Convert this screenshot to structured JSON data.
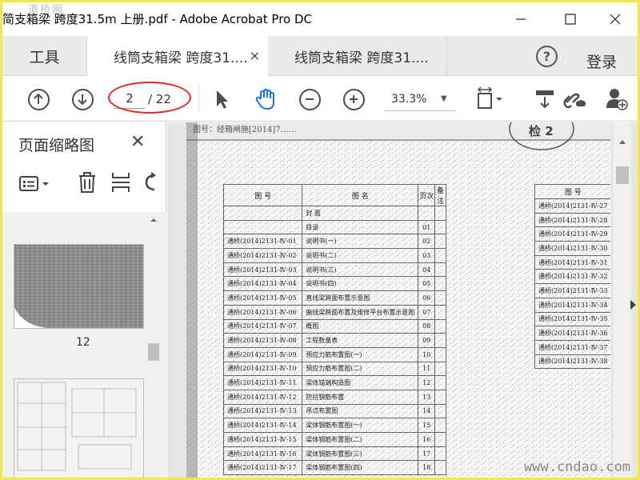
{
  "window": {
    "title": "简支箱梁 跨度31.5m 上册.pdf - Adobe Acrobat Pro DC",
    "watermark_top": "道桥网",
    "min_icon": "minimize-icon",
    "max_icon": "maximize-icon",
    "close_icon": "close-icon"
  },
  "tabs": {
    "tools": "工具",
    "active_label": "线筒支箱梁 跨度31....",
    "inactive_label": "线筒支箱梁 跨度31....",
    "close_glyph": "×",
    "help_glyph": "?",
    "login": "登录"
  },
  "toolbar": {
    "page_current": "2",
    "page_total": "/ 22",
    "zoom": "33.3%",
    "icons": [
      "prev-page-icon",
      "next-page-icon",
      "select-arrow-icon",
      "hand-tool-icon",
      "zoom-out-icon",
      "zoom-in-icon",
      "fit-page-icon",
      "scroll-mode-icon",
      "share-link-icon",
      "add-user-icon"
    ]
  },
  "sidebar": {
    "title": "页面缩略图",
    "close_glyph": "✕",
    "thumb_label": "12"
  },
  "document": {
    "header_fragment": "图号：经箱闸施[2014]7……",
    "stamp": "检 2",
    "table1_headers": [
      "图 号",
      "图 名",
      "页次",
      "备注"
    ],
    "table1_rows": [
      [
        "",
        "封 面",
        "",
        ""
      ],
      [
        "",
        "目录",
        "01",
        ""
      ],
      [
        "通桥(2014)2131-Ⅳ-01",
        "说明书(一)",
        "02",
        ""
      ],
      [
        "通桥(2014)2131-Ⅳ-02",
        "说明书(二)",
        "03",
        ""
      ],
      [
        "通桥(2014)2131-Ⅳ-03",
        "说明书(三)",
        "04",
        ""
      ],
      [
        "通桥(2014)2131-Ⅳ-04",
        "说明书(四)",
        "05",
        ""
      ],
      [
        "通桥(2014)2131-Ⅳ-05",
        "直线梁跨面布置示意图",
        "06",
        ""
      ],
      [
        "通桥(2014)2131-Ⅳ-06",
        "曲线梁跨面布置及维修平台布置示意图",
        "07",
        ""
      ],
      [
        "通桥(2014)2131-Ⅳ-07",
        "概图",
        "08",
        ""
      ],
      [
        "通桥(2014)2131-Ⅳ-08",
        "工程数量表",
        "09",
        ""
      ],
      [
        "通桥(2014)2131-Ⅳ-09",
        "预应力筋布置图(一)",
        "10",
        ""
      ],
      [
        "通桥(2014)2131-Ⅳ-10",
        "预应力筋布置图(二)",
        "11",
        ""
      ],
      [
        "通桥(2014)2131-Ⅳ-11",
        "梁体锚端构造图",
        "12",
        ""
      ],
      [
        "通桥(2014)2131-Ⅳ-12",
        "防拉钢筋布置",
        "13",
        ""
      ],
      [
        "通桥(2014)2131-Ⅳ-13",
        "吊点布置图",
        "14",
        ""
      ],
      [
        "通桥(2014)2131-Ⅳ-14",
        "梁体钢筋布置图(一)",
        "15",
        ""
      ],
      [
        "通桥(2014)2131-Ⅳ-15",
        "梁体钢筋布置图(二)",
        "16",
        ""
      ],
      [
        "通桥(2014)2131-Ⅳ-16",
        "梁体钢筋布置图(三)",
        "17",
        ""
      ],
      [
        "通桥(2014)2131-Ⅳ-17",
        "梁体钢筋布置图(四)",
        "18",
        ""
      ]
    ],
    "table2_header": "图 号",
    "table2_rows": [
      "通桥(2014)2131-Ⅳ-27",
      "通桥(2014)2131-Ⅳ-28",
      "通桥(2014)2131-Ⅳ-29",
      "通桥(2014)2131-Ⅳ-30",
      "通桥(2014)2131-Ⅳ-31",
      "通桥(2014)2131-Ⅳ-32",
      "通桥(2014)2131-Ⅳ-33",
      "通桥(2014)2131-Ⅳ-34",
      "通桥(2014)2131-Ⅳ-35",
      "通桥(2014)2131-Ⅳ-36",
      "通桥(2014)2131-Ⅳ-37",
      "通桥(2014)2131-Ⅳ-38"
    ],
    "watermark_bottom": "www.cndao.com"
  }
}
